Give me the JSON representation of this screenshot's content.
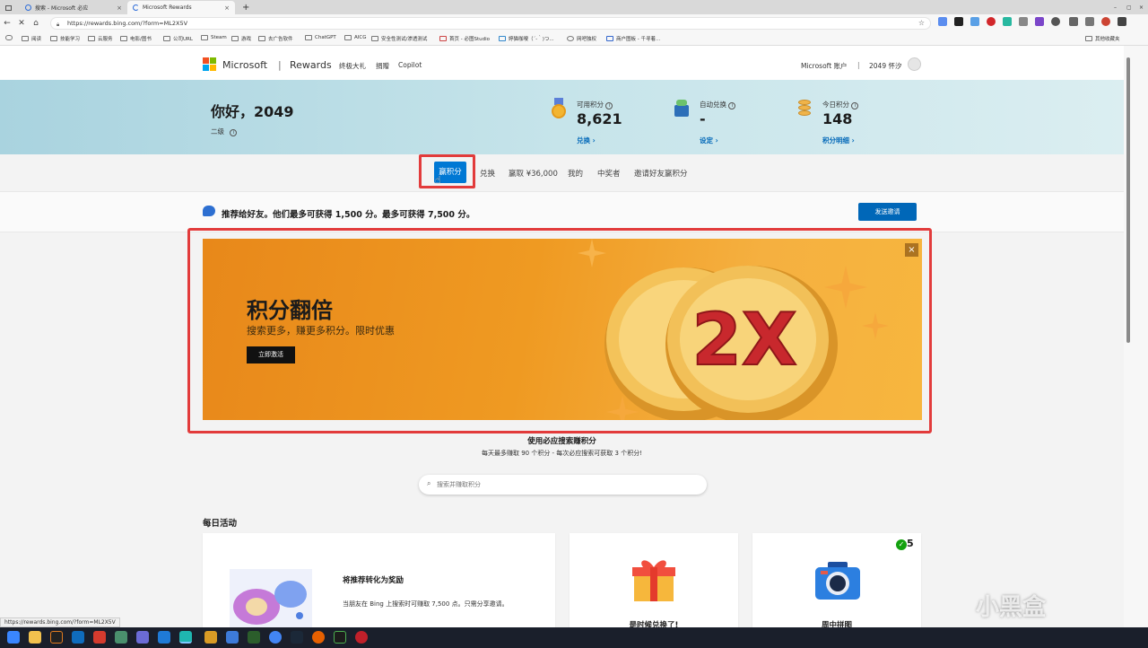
{
  "browser": {
    "tabs": [
      {
        "label": "搜索 - Microsoft 必应",
        "close": "×"
      },
      {
        "label": "Microsoft Rewards",
        "close": "×"
      }
    ],
    "new_tab": "+",
    "url": "https://rewards.bing.com/?form=ML2X5V",
    "window_controls": {
      "minimize": "–",
      "maximize": "▢",
      "close": "×"
    },
    "bookmarks": [
      "阅读",
      "技能学习",
      "云服务",
      "电影/图书",
      "公司URL",
      "Steam",
      "游戏",
      "去广告软件",
      "ChatGPT",
      "AICG",
      "安全性测试/渗透测试",
      "首页 - 必图Studio",
      "婷猫咖嗖（´-｀)つ...",
      "网吧独权",
      "商户图板 - 千寻着..."
    ],
    "other_favorites": "其他收藏夹"
  },
  "header": {
    "brand": "Microsoft",
    "divider": "|",
    "product": "Rewards",
    "nav": [
      "终极大礼",
      "捐赠",
      "Copilot"
    ],
    "account": "Microsoft 账户",
    "sep": "|",
    "user": "2049 怀汐"
  },
  "hero": {
    "greeting": "你好，2049",
    "level": "二级",
    "stats": [
      {
        "label": "可用积分",
        "value": "8,621",
        "link": "兑换 ›"
      },
      {
        "label": "自动兑换",
        "value": "-",
        "link": "设定 ›"
      },
      {
        "label": "今日积分",
        "value": "148",
        "link": "积分明细 ›"
      }
    ]
  },
  "page_tabs": [
    "赢积分",
    "兑换",
    "赢取 ¥36,000",
    "我的",
    "中奖者",
    "邀请好友赢积分"
  ],
  "referral": {
    "text": "推荐给好友。他们最多可获得 1,500 分。最多可获得 7,500 分。",
    "button": "发送邀请"
  },
  "banner": {
    "title": "积分翻倍",
    "subtitle": "搜索更多，赚更多积分。限时优惠",
    "button": "立即激活",
    "coin_text": "2X",
    "close": "×"
  },
  "search_section": {
    "title": "使用必应搜索赚积分",
    "subtitle": "每天最多赚取 90 个积分 - 每次必应搜索可获取 3 个积分!",
    "placeholder": "搜索并赚取积分"
  },
  "daily": {
    "title": "每日活动",
    "cards": [
      {
        "title": "将推荐转化为奖励",
        "desc": "当朋友在 Bing 上搜索时可赚取 7,500 点。只需分享邀请。"
      },
      {
        "title": "是时候兑换了!"
      },
      {
        "title": "周中拼图",
        "badge": "5"
      }
    ]
  },
  "status_url": "https://rewards.bing.com/?form=ML2X5V",
  "watermark": "小黑盒",
  "colors": {
    "accent": "#0078d4",
    "highlight": "#e23b3b",
    "banner": "#ef9a22"
  }
}
